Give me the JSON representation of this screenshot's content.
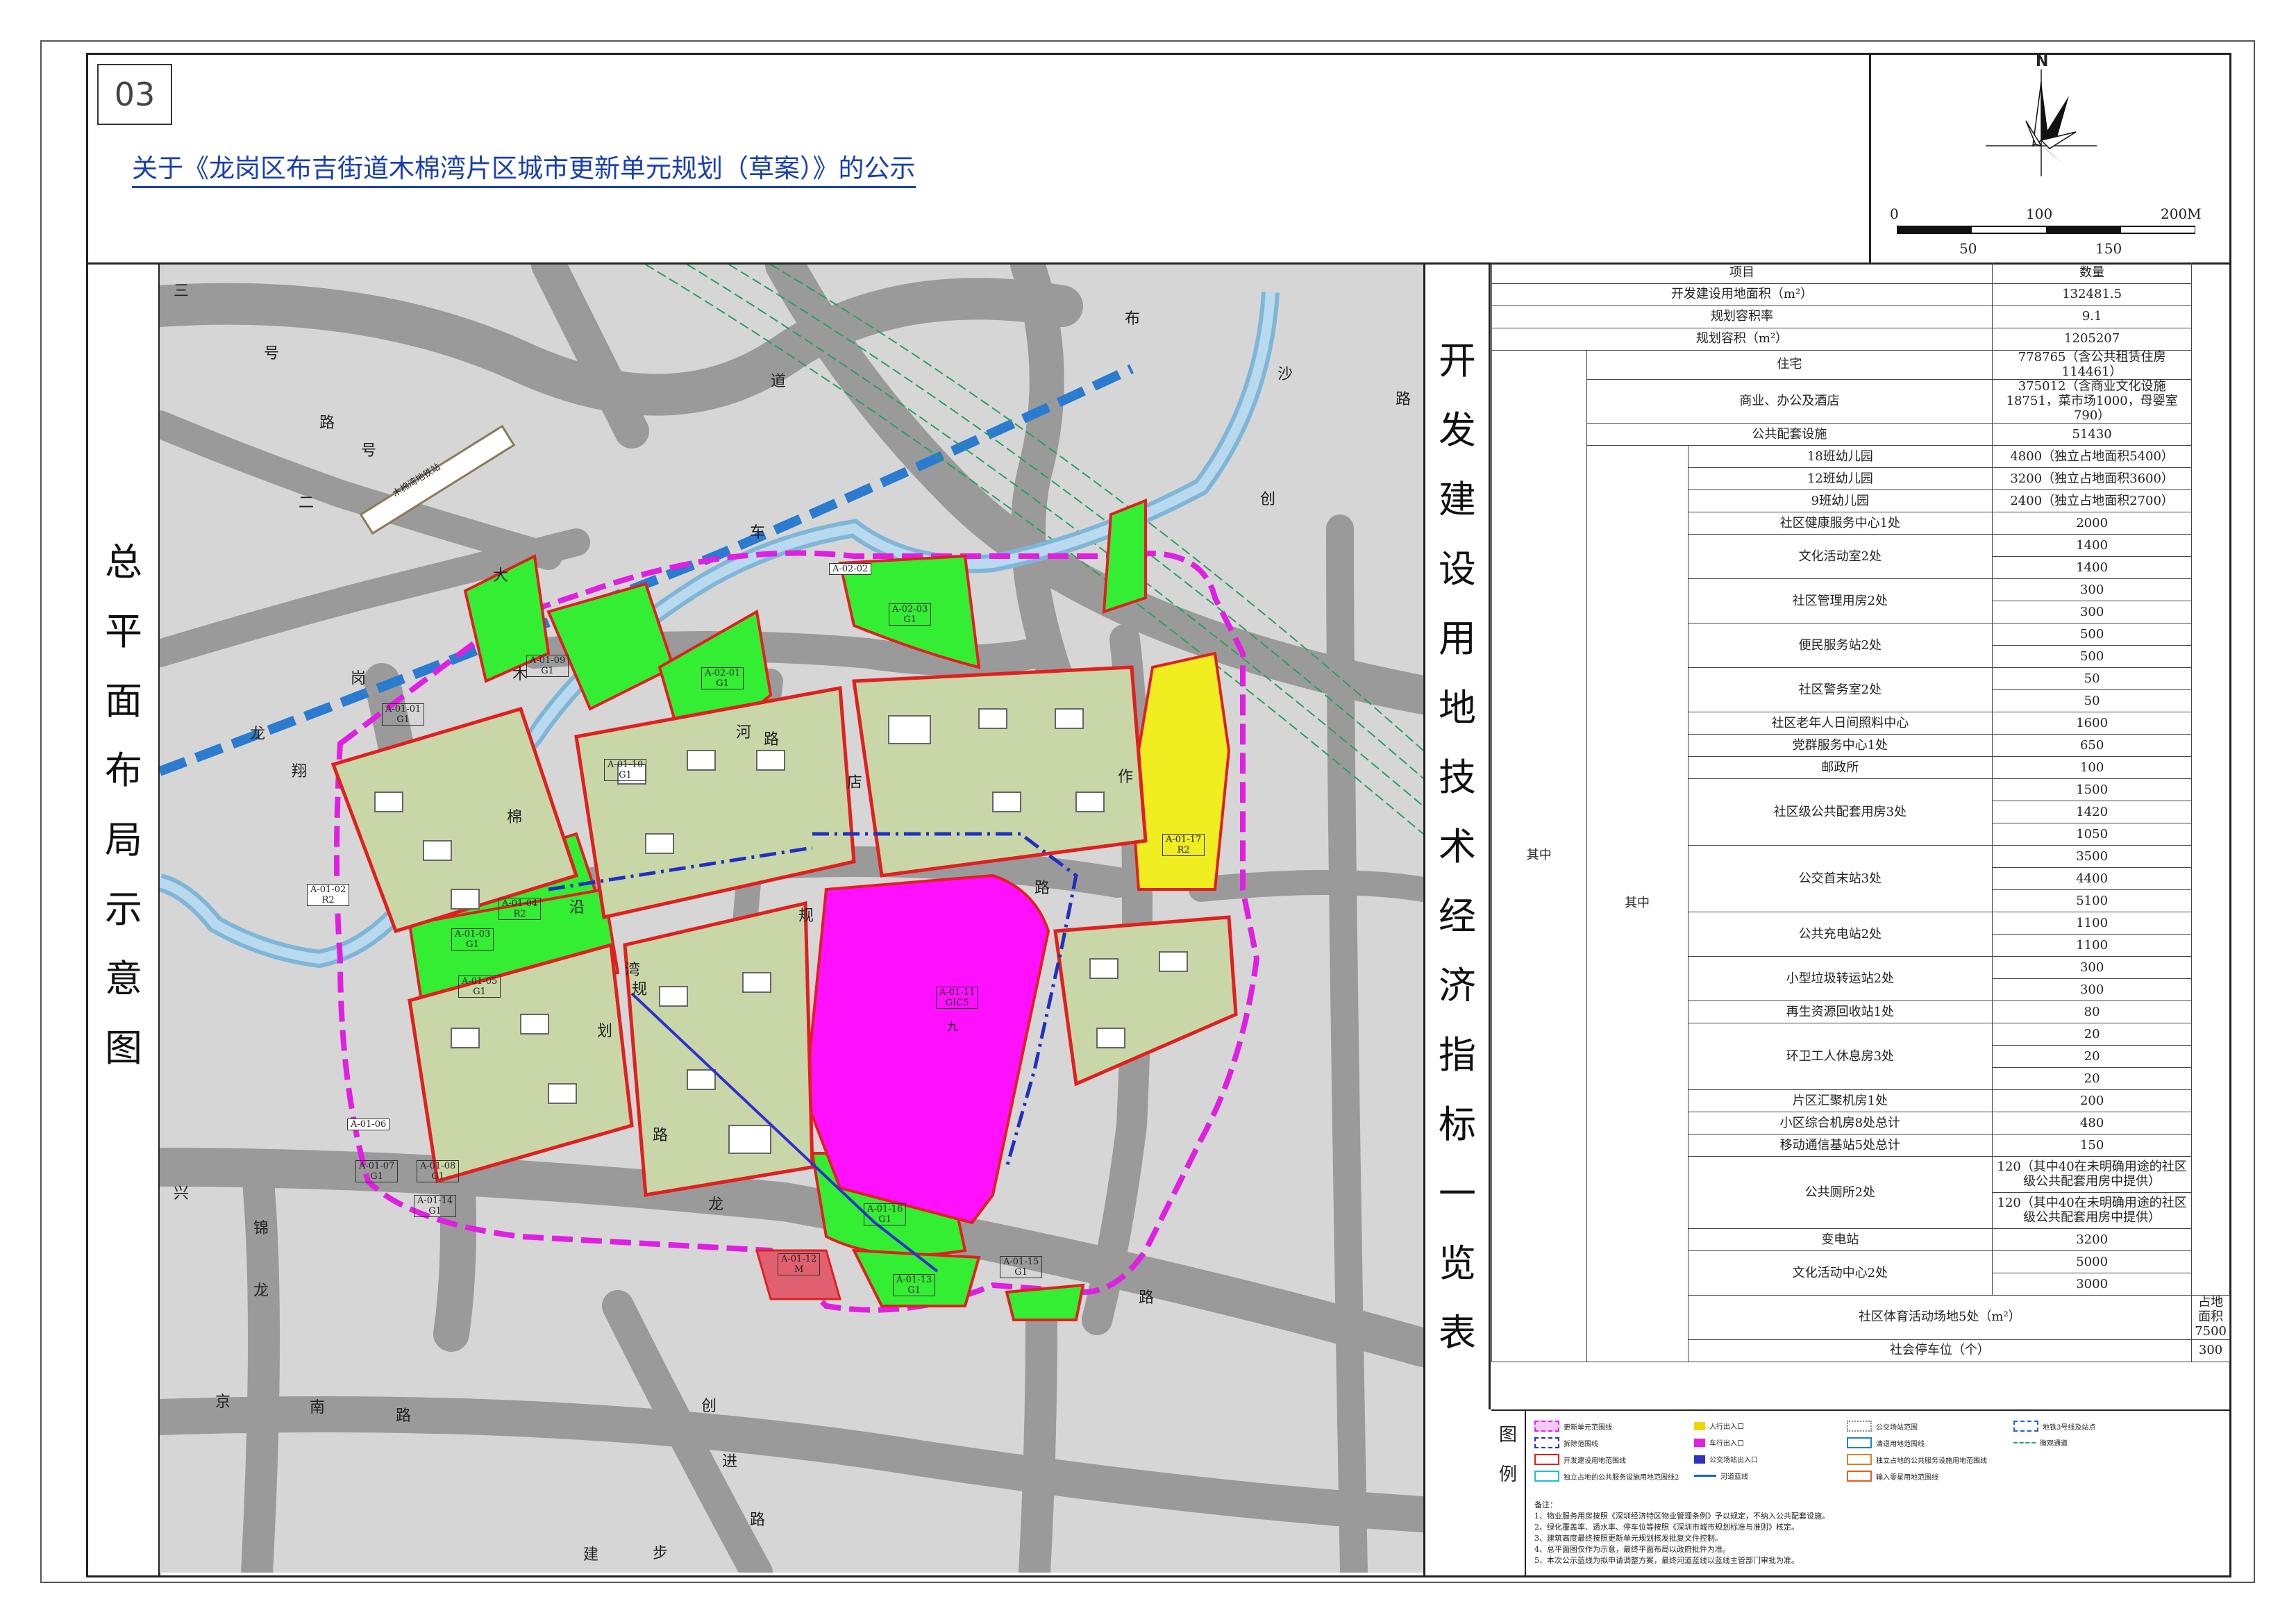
{
  "sheet_no": "03",
  "title": "关于《龙岗区布吉街道木棉湾片区城市更新单元规划（草案）》的公示",
  "left_vertical_title": [
    "总",
    "平",
    "面",
    "布",
    "局",
    "示",
    "意",
    "图"
  ],
  "right_vertical_title": [
    "开",
    "发",
    "建",
    "设",
    "用",
    "地",
    "技",
    "术",
    "经",
    "济",
    "指",
    "标",
    "一",
    "览",
    "表"
  ],
  "compass": {
    "north": "N"
  },
  "scale_bar": {
    "top_labels": [
      "0",
      "100",
      "200M"
    ],
    "bottom_labels": [
      "50",
      "150"
    ]
  },
  "map": {
    "roads": [
      {
        "name": "三号路二号路",
        "chars": [
          "三",
          "号",
          "路",
          "号",
          "二"
        ]
      },
      {
        "name": "布沙路",
        "chars": [
          "布",
          "沙",
          "路"
        ]
      },
      {
        "name": "车",
        "chars": [
          "车"
        ]
      },
      {
        "name": "道",
        "chars": [
          "道"
        ]
      },
      {
        "name": "创",
        "chars": [
          "创"
        ]
      },
      {
        "name": "大岗龙翔",
        "chars": [
          "大",
          "岗",
          "龙",
          "翔"
        ]
      },
      {
        "name": "木棉沿湾路",
        "chars": [
          "木",
          "棉",
          "沿",
          "湾",
          "路"
        ]
      },
      {
        "name": "河店作路",
        "chars": [
          "路",
          "河",
          "店",
          "作",
          "路"
        ]
      },
      {
        "name": "规划路",
        "chars": [
          "规",
          "划",
          "规",
          "路"
        ]
      },
      {
        "name": "兴龙路",
        "chars": [
          "兴",
          "龙",
          "路"
        ]
      },
      {
        "name": "锦龙",
        "chars": [
          "锦",
          "龙"
        ]
      },
      {
        "name": "京南路",
        "chars": [
          "京",
          "南",
          "路"
        ]
      },
      {
        "name": "创进路建步",
        "chars": [
          "创",
          "进",
          "路",
          "建",
          "步"
        ]
      }
    ],
    "station_label": "木棉湾地铁站",
    "parcels": [
      {
        "id": "A-02-02",
        "use": ""
      },
      {
        "id": "A-02-03",
        "use": "G1"
      },
      {
        "id": "A-01-09",
        "use": "G1"
      },
      {
        "id": "A-02-01",
        "use": "G1"
      },
      {
        "id": "A-01-01",
        "use": "G1"
      },
      {
        "id": "A-01-10",
        "use": "G1"
      },
      {
        "id": "A-01-02",
        "use": "R2"
      },
      {
        "id": "A-01-04",
        "use": "R2"
      },
      {
        "id": "A-01-03",
        "use": "G1"
      },
      {
        "id": "A-01-05",
        "use": "G1"
      },
      {
        "id": "A-01-17",
        "use": "R2"
      },
      {
        "id": "A-01-11",
        "use": "GIC5"
      },
      {
        "id": "A-01-06",
        "use": ""
      },
      {
        "id": "A-01-07",
        "use": "G1"
      },
      {
        "id": "A-01-08",
        "use": "G1"
      },
      {
        "id": "A-01-14",
        "use": "G1"
      },
      {
        "id": "A-01-16",
        "use": "G1"
      },
      {
        "id": "A-01-12",
        "use": "M"
      },
      {
        "id": "A-01-13",
        "use": "G1"
      },
      {
        "id": "A-01-15",
        "use": "G1"
      }
    ],
    "school_char": "九"
  },
  "table": {
    "header": [
      "项目",
      "数量"
    ],
    "top_rows": [
      {
        "label": "开发建设用地面积（m²）",
        "value": "132481.5"
      },
      {
        "label": "规划容积率",
        "value": "9.1"
      },
      {
        "label": "规划容积（m²）",
        "value": "1205207"
      }
    ],
    "group_label": "其中",
    "mid_rows": [
      {
        "label": "住宅",
        "value": "778765（含公共租赁住房114461）"
      },
      {
        "label": "商业、办公及酒店",
        "value": "375012（含商业文化设施18751，菜市场1000，母婴室790）"
      },
      {
        "label": "公共配套设施",
        "value": "51430"
      }
    ],
    "sub_group_label": "其中",
    "facility_rows": [
      {
        "label": "18班幼儿园",
        "values": [
          "4800（独立占地面积5400）"
        ]
      },
      {
        "label": "12班幼儿园",
        "values": [
          "3200（独立占地面积3600）"
        ]
      },
      {
        "label": "9班幼儿园",
        "values": [
          "2400（独立占地面积2700）"
        ]
      },
      {
        "label": "社区健康服务中心1处",
        "values": [
          "2000"
        ]
      },
      {
        "label": "文化活动室2处",
        "values": [
          "1400",
          "1400"
        ]
      },
      {
        "label": "社区管理用房2处",
        "values": [
          "300",
          "300"
        ]
      },
      {
        "label": "便民服务站2处",
        "values": [
          "500",
          "500"
        ]
      },
      {
        "label": "社区警务室2处",
        "values": [
          "50",
          "50"
        ]
      },
      {
        "label": "社区老年人日间照料中心",
        "values": [
          "1600"
        ]
      },
      {
        "label": "党群服务中心1处",
        "values": [
          "650"
        ]
      },
      {
        "label": "邮政所",
        "values": [
          "100"
        ]
      },
      {
        "label": "社区级公共配套用房3处",
        "values": [
          "1500",
          "1420",
          "1050"
        ]
      },
      {
        "label": "公交首末站3处",
        "values": [
          "3500",
          "4400",
          "5100"
        ]
      },
      {
        "label": "公共充电站2处",
        "values": [
          "1100",
          "1100"
        ]
      },
      {
        "label": "小型垃圾转运站2处",
        "values": [
          "300",
          "300"
        ]
      },
      {
        "label": "再生资源回收站1处",
        "values": [
          "80"
        ]
      },
      {
        "label": "环卫工人休息房3处",
        "values": [
          "20",
          "20",
          "20"
        ]
      },
      {
        "label": "片区汇聚机房1处",
        "values": [
          "200"
        ]
      },
      {
        "label": "小区综合机房8处总计",
        "values": [
          "480"
        ]
      },
      {
        "label": "移动通信基站5处总计",
        "values": [
          "150"
        ]
      },
      {
        "label": "公共厕所2处",
        "values": [
          "120（其中40在未明确用途的社区级公共配套用房中提供）",
          "120（其中40在未明确用途的社区级公共配套用房中提供）"
        ]
      },
      {
        "label": "变电站",
        "values": [
          "3200"
        ]
      },
      {
        "label": "文化活动中心2处",
        "values": [
          "5000",
          "3000"
        ]
      }
    ],
    "bottom_rows": [
      {
        "label": "社区体育活动场地5处（m²）",
        "value": "占地面积7500"
      },
      {
        "label": "社会停车位（个）",
        "value": "300"
      }
    ]
  },
  "legend": {
    "title": [
      "图",
      "例"
    ],
    "items": [
      {
        "label": "更新单元范围线",
        "color": "#e020e0"
      },
      {
        "label": "人行出入口",
        "color": "#f2d400"
      },
      {
        "label": "公交场站范围",
        "color": "#888888"
      },
      {
        "label": "地铁3号线及站点",
        "color": "#2060d0"
      },
      {
        "label": "拆除范围线",
        "color": "#2030c0"
      },
      {
        "label": "车行出入口",
        "color": "#e020e0"
      },
      {
        "label": "清退用地范围线",
        "color": "#2080d0"
      },
      {
        "label": "微观通道",
        "color": "#20a060"
      },
      {
        "label": "开发建设用地范围线",
        "color": "#e02020"
      },
      {
        "label": "公交场站出入口",
        "color": "#3030c0"
      },
      {
        "label": "独立占地的公共服务设施用地范围线",
        "color": "#e08020"
      },
      {
        "label": "独立占地的公共服务设施用地范围线2",
        "color": "#20c0d0"
      },
      {
        "label": "河道蓝线",
        "color": "#2060d0"
      },
      {
        "label": "输入零星用地范围线",
        "color": "#e06020"
      }
    ],
    "notes_title": "备注：",
    "notes": [
      "1、物业服务用房按照《深圳经济特区物业管理条例》予以规定，不纳入公共配套设施。",
      "2、绿化覆盖率、透水率、停车位等按照《深圳市城市规划标准与准则》核定。",
      "3、建筑高度最终按照更新单元规划核发批复文件控制。",
      "4、总平面图仅作为示意，最终平面布局以政府批件为准。",
      "5、本次公示蓝线为拟申请调整方案，最终河道蓝线以蓝线主管部门审批为准。"
    ]
  }
}
